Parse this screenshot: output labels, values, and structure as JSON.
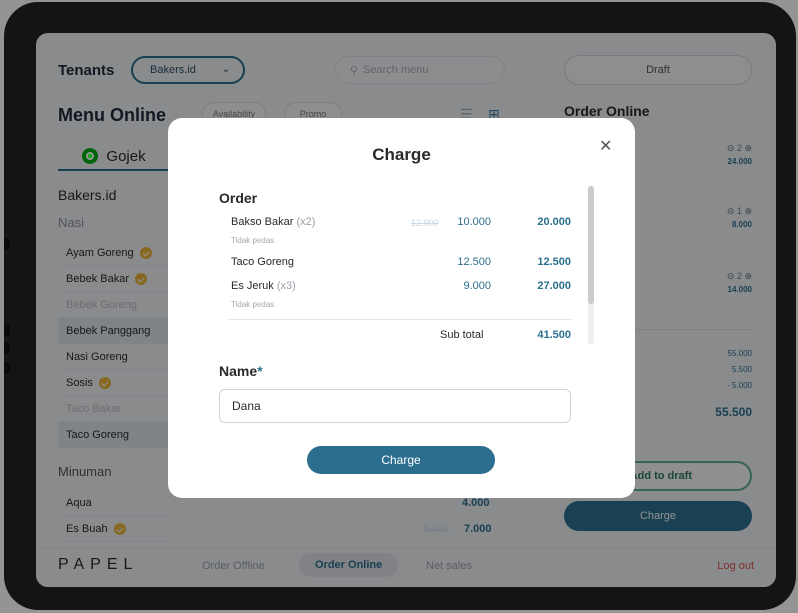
{
  "header": {
    "tenants_label": "Tenants",
    "tenant_selected": "Bakers.id",
    "search_placeholder": "Search menu",
    "draft_label": "Draft"
  },
  "menu": {
    "title": "Menu Online",
    "pills": [
      "Availability",
      "Promo"
    ],
    "tab_label": "Gojek",
    "store_name": "Bakers.id",
    "category_nasi": "Nasi",
    "category_minuman": "Minuman",
    "items": [
      {
        "name": "Ayam Goreng",
        "badge": true,
        "state": "normal"
      },
      {
        "name": "Bebek Bakar",
        "badge": true,
        "state": "normal"
      },
      {
        "name": "Bebek Goreng",
        "badge": false,
        "state": "disabled"
      },
      {
        "name": "Bebek Panggang",
        "badge": false,
        "state": "selected"
      },
      {
        "name": "Nasi Goreng",
        "badge": false,
        "state": "normal"
      },
      {
        "name": "Sosis",
        "badge": true,
        "state": "normal"
      },
      {
        "name": "Taco Bakar",
        "badge": false,
        "state": "disabled"
      },
      {
        "name": "Taco Goreng",
        "badge": false,
        "state": "selected"
      }
    ],
    "drinks": [
      {
        "name": "Aqua",
        "badge": false,
        "price": "4.000",
        "old_price": ""
      },
      {
        "name": "Es Buah",
        "badge": true,
        "price": "7.000",
        "old_price": "8.000"
      }
    ]
  },
  "order_panel": {
    "title": "Order Online",
    "lines": [
      {
        "qty": "2",
        "price": "24.000"
      },
      {
        "qty": "1",
        "price": "8.000"
      },
      {
        "qty": "2",
        "price": "14.000"
      }
    ],
    "summary": [
      "55.000",
      "5.500",
      "- 5.000"
    ],
    "total": "55.500",
    "add_to_draft": "Add to draft",
    "charge": "Charge"
  },
  "bottom_nav": {
    "logo": "PAPEL",
    "items": [
      "Order Offline",
      "Order Online",
      "Net sales"
    ],
    "active": "Order Online",
    "logout": "Log out"
  },
  "modal": {
    "title": "Charge",
    "order_label": "Order",
    "rows": [
      {
        "name": "Bakso Bakar",
        "qty": "(x2)",
        "old_price": "12.000",
        "unit": "10.000",
        "subtotal": "20.000",
        "note": "Tidak pedas"
      },
      {
        "name": "Taco Goreng",
        "qty": "",
        "old_price": "",
        "unit": "12.500",
        "subtotal": "12.500",
        "note": ""
      },
      {
        "name": "Es Jeruk",
        "qty": "(x3)",
        "old_price": "",
        "unit": "9.000",
        "subtotal": "27.000",
        "note": "Tidak pedas"
      }
    ],
    "subtotal_label": "Sub total",
    "subtotal_value": "41.500",
    "name_label": "Name",
    "name_required": "*",
    "name_value": "Dana",
    "charge_button": "Charge"
  },
  "colors": {
    "primary": "#2c6e8f",
    "success": "#5cae8a",
    "danger": "#d9534f",
    "badge": "#e8b33a"
  }
}
